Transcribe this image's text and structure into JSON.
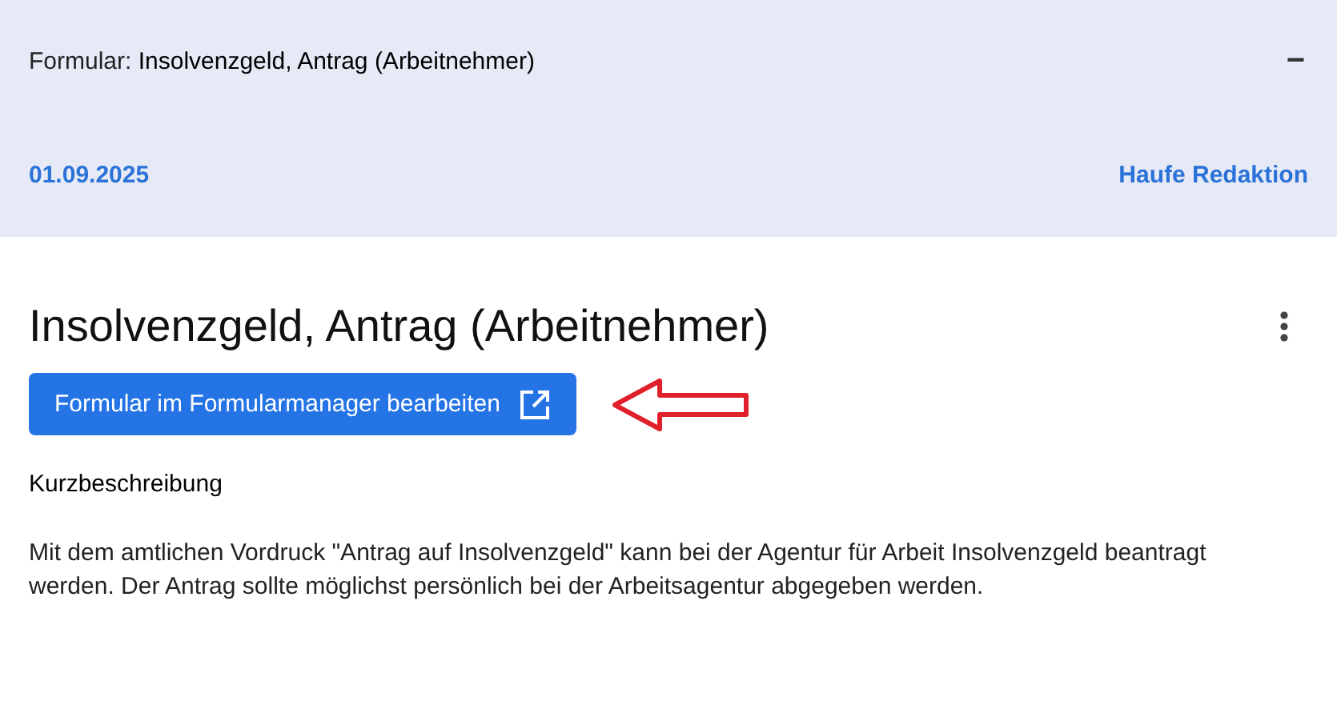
{
  "header": {
    "title": "Formular: **Insolvenzgeld, Antrag (Arbeitnehmer)**",
    "collapse_icon": "−",
    "date": "01.09.2025",
    "author": "Haufe Redaktion"
  },
  "content": {
    "title": "Insolvenzgeld, Antrag (Arbeitnehmer)",
    "edit_button": "Formular im Formularmanager bearbeiten",
    "section_heading": "Kurzbeschreibung",
    "description": "Mit dem amtlichen Vordruck \"Antrag auf Insolvenzgeld\" kann bei der Agentur für Arbeit Insolvenzgeld beantragt werden. Der Antrag sollte möglichst persönlich bei der Arbeitsagentur abgegeben werden."
  }
}
